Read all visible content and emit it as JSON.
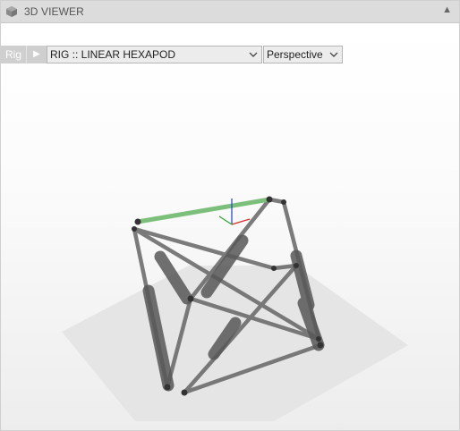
{
  "panel": {
    "title": "3D VIEWER",
    "icon": "cube-icon",
    "collapse_icon": "triangle-up-icon"
  },
  "toolbar": {
    "rig_label": "Rig",
    "play_icon": "play-icon",
    "rig_selected": "RIG :: LINEAR HEXAPOD",
    "view_selected": "Perspective"
  },
  "colors": {
    "highlight_edge": "#7bbf7b",
    "axis_x": "#d23030",
    "axis_y": "#2ea02e",
    "axis_z": "#2040c8"
  }
}
